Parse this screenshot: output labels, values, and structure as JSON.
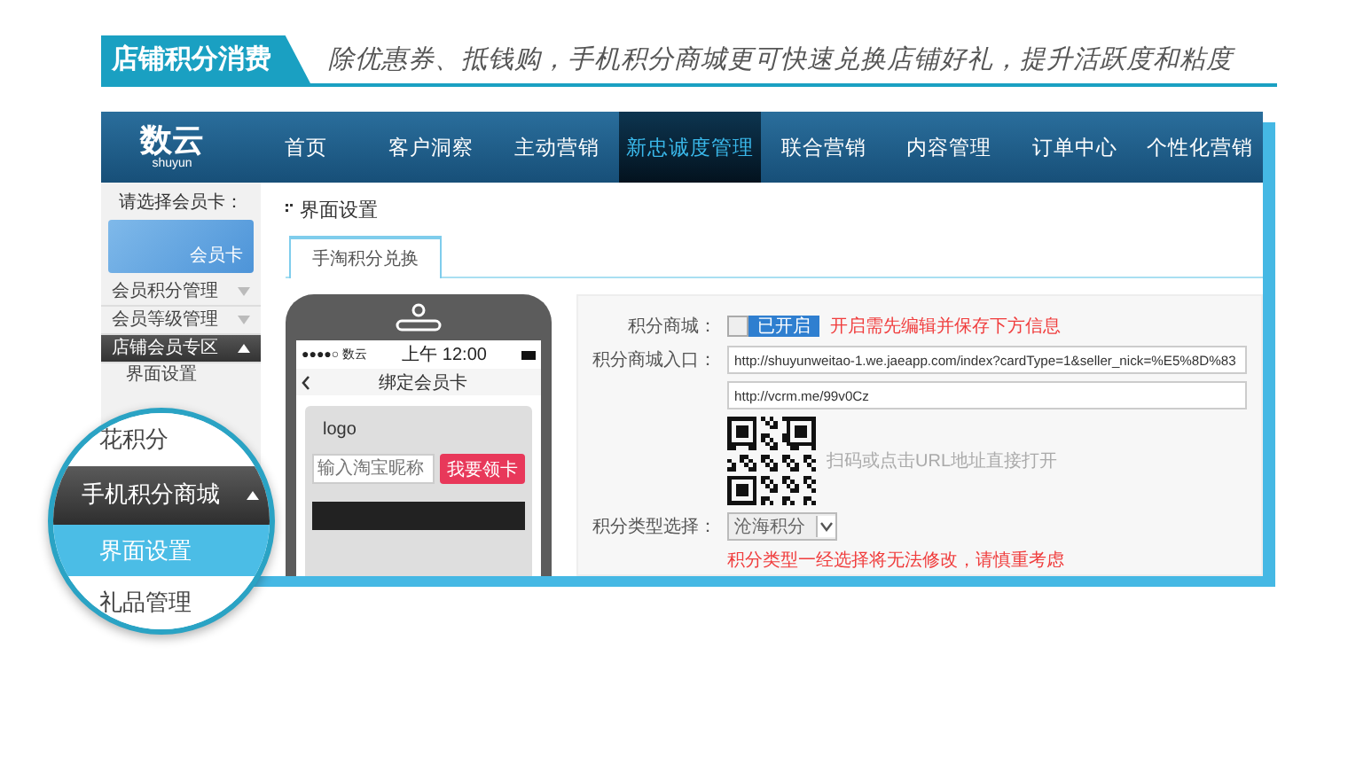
{
  "header": {
    "title": "店铺积分消费",
    "subtitle": "除优惠券、抵钱购，手机积分商城更可快速兑换店铺好礼，提升活跃度和粘度"
  },
  "app": {
    "logo": {
      "name": "数云",
      "sub": "shuyun"
    },
    "nav": [
      {
        "label": "首页",
        "selected": false
      },
      {
        "label": "客户洞察",
        "selected": false
      },
      {
        "label": "主动营销",
        "selected": false
      },
      {
        "label": "新忠诚度管理",
        "selected": true
      },
      {
        "label": "联合营销",
        "selected": false
      },
      {
        "label": "内容管理",
        "selected": false
      },
      {
        "label": "订单中心",
        "selected": false
      },
      {
        "label": "个性化营销",
        "selected": false
      }
    ],
    "sidebar": {
      "card_prompt": "请选择会员卡：",
      "card_label": "会员卡",
      "items": [
        {
          "label": "会员积分管理",
          "expanded": false
        },
        {
          "label": "会员等级管理",
          "expanded": false
        },
        {
          "label": "店铺会员专区",
          "expanded": true,
          "children": [
            {
              "label": "界面设置"
            }
          ]
        }
      ]
    },
    "breadcrumb": "界面设置",
    "tabs": [
      {
        "label": "手淘积分兑换",
        "selected": true
      }
    ],
    "phone": {
      "carrier": "●●●●○ 数云",
      "time": "上午 12:00",
      "title": "绑定会员卡",
      "logo": "logo",
      "placeholder": "输入淘宝昵称",
      "button": "我要领卡"
    },
    "form": {
      "switch_label": "积分商城：",
      "switch": {
        "on": true,
        "label": "已开启"
      },
      "switch_note": "开启需先编辑并保存下方信息",
      "entry_label": "积分商城入口：",
      "urls": [
        "http://shuyunweitao-1.we.jaeapp.com/index?cardType=1&seller_nick=%E5%8D%83",
        "http://vcrm.me/99v0Cz"
      ],
      "qr_hint": "扫码或点击URL地址直接打开",
      "type_label": "积分类型选择：",
      "type_value": "沧海积分",
      "type_warning": "积分类型一经选择将无法修改，请慎重考虑"
    }
  },
  "magnifier": [
    {
      "label": "花积分",
      "kind": "item",
      "selected": false
    },
    {
      "label": "手机积分商城",
      "kind": "group",
      "selected": false
    },
    {
      "label": "界面设置",
      "kind": "item",
      "selected": true
    },
    {
      "label": "礼品管理",
      "kind": "item",
      "selected": false
    }
  ]
}
